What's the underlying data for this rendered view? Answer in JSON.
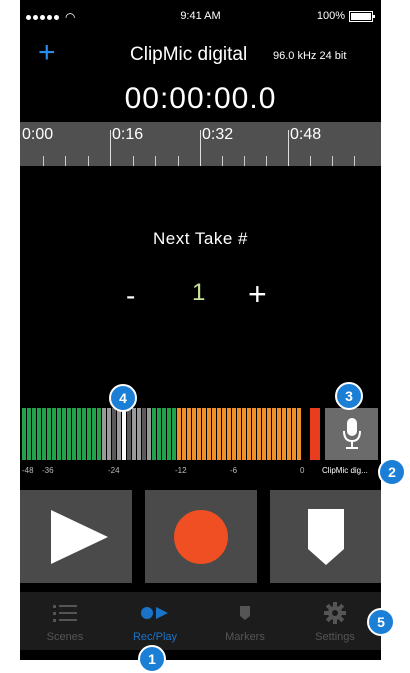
{
  "status_bar": {
    "time": "9:41 AM",
    "battery": "100%"
  },
  "nav": {
    "add_icon": "+",
    "title": "ClipMic digital",
    "sample_rate": "96.0 kHz 24 bit"
  },
  "recorder": {
    "time_display": "00:00:00.0",
    "timeline_labels": [
      "0:00",
      "0:16",
      "0:32",
      "0:48"
    ],
    "next_take_label": "Next Take #",
    "take_number": "1",
    "minus": "-",
    "plus": "+"
  },
  "meter": {
    "scale": [
      "-48",
      "-36",
      "-24",
      "-12",
      "-6",
      "0"
    ],
    "device": "ClipMic dig...",
    "colors": {
      "green": "#22a24a",
      "grey": "#9a9a9a",
      "orange": "#f0902a",
      "red": "#e83e1e"
    }
  },
  "transport": {
    "play_icon": "play-icon",
    "record_icon": "record-icon",
    "marker_icon": "marker-icon"
  },
  "tabs": [
    {
      "label": "Scenes",
      "icon": "list-icon"
    },
    {
      "label": "Rec/Play",
      "icon": "rec-play-icon",
      "active": true
    },
    {
      "label": "Markers",
      "icon": "marker-icon"
    },
    {
      "label": "Settings",
      "icon": "gear-icon"
    }
  ],
  "callouts": [
    "1",
    "2",
    "3",
    "4",
    "5"
  ],
  "accent_color": "#1b7fd6"
}
